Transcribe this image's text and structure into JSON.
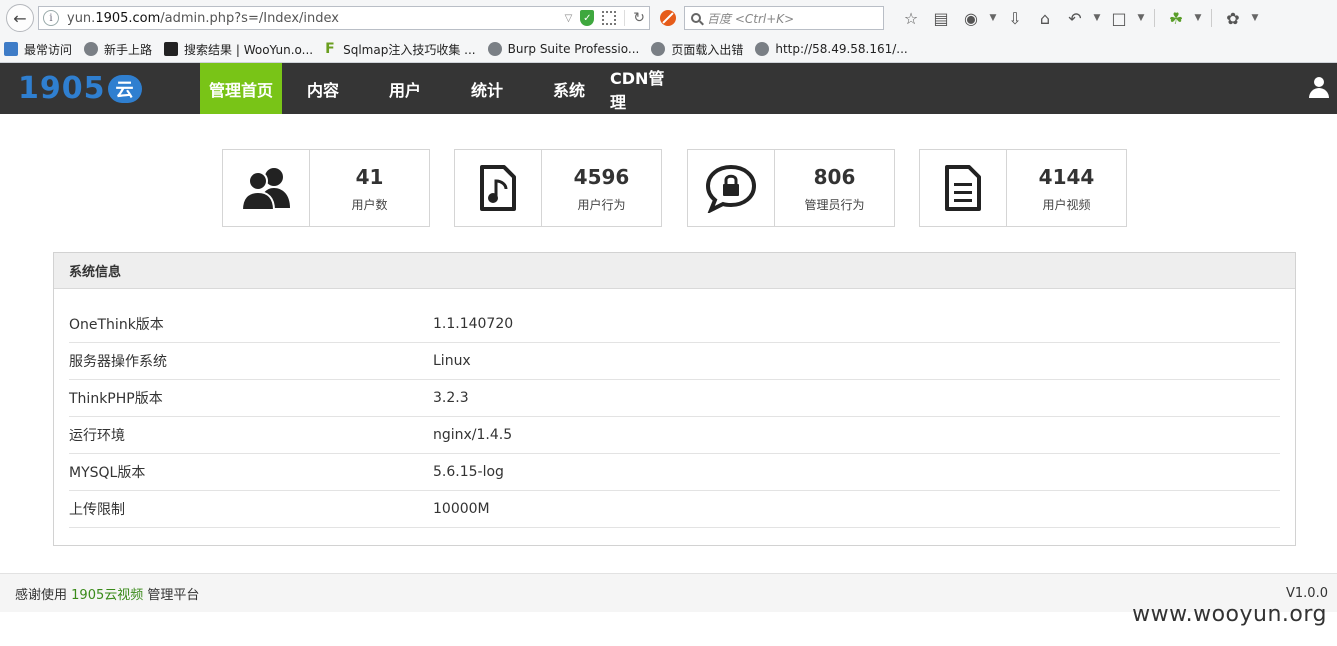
{
  "browser": {
    "url_prefix": "yun.",
    "url_host": "1905.com",
    "url_path": "/admin.php?s=/Index/index",
    "search_placeholder": "百度 <Ctrl+K>",
    "bookmarks": [
      {
        "label": "最常访问",
        "icon": "folder"
      },
      {
        "label": "新手上路",
        "icon": "globe"
      },
      {
        "label": "搜索结果 | WooYun.o...",
        "icon": "dark"
      },
      {
        "label": "Sqlmap注入技巧收集 ...",
        "icon": "green-f"
      },
      {
        "label": "Burp Suite Professio...",
        "icon": "globe"
      },
      {
        "label": "页面载入出错",
        "icon": "globe"
      },
      {
        "label": "http://58.49.58.161/...",
        "icon": "globe"
      }
    ]
  },
  "header": {
    "logo_number": "1905",
    "logo_cloud": "云",
    "nav": [
      {
        "label": "管理首页",
        "active": true
      },
      {
        "label": "内容",
        "active": false
      },
      {
        "label": "用户",
        "active": false
      },
      {
        "label": "统计",
        "active": false
      },
      {
        "label": "系统",
        "active": false
      },
      {
        "label": "CDN管理",
        "active": false
      }
    ]
  },
  "stats": [
    {
      "value": "41",
      "label": "用户数",
      "icon": "users-icon"
    },
    {
      "value": "4596",
      "label": "用户行为",
      "icon": "music-file-icon"
    },
    {
      "value": "806",
      "label": "管理员行为",
      "icon": "lock-chat-icon"
    },
    {
      "value": "4144",
      "label": "用户视频",
      "icon": "document-icon"
    }
  ],
  "panel": {
    "title": "系统信息",
    "rows": [
      {
        "key": "OneThink版本",
        "value": "1.1.140720"
      },
      {
        "key": "服务器操作系统",
        "value": "Linux"
      },
      {
        "key": "ThinkPHP版本",
        "value": "3.2.3"
      },
      {
        "key": "运行环境",
        "value": "nginx/1.4.5"
      },
      {
        "key": "MYSQL版本",
        "value": "5.6.15-log"
      },
      {
        "key": "上传限制",
        "value": "10000M"
      }
    ]
  },
  "footer": {
    "prefix": "感谢使用",
    "brand": "1905云视频",
    "suffix": "管理平台",
    "version": "V1.0.0"
  },
  "watermark": "www.wooyun.org",
  "colors": {
    "header_bg": "#353535",
    "nav_active": "#79c417",
    "logo_blue": "#2f7fd0",
    "footer_brand": "#3a8a1a"
  }
}
